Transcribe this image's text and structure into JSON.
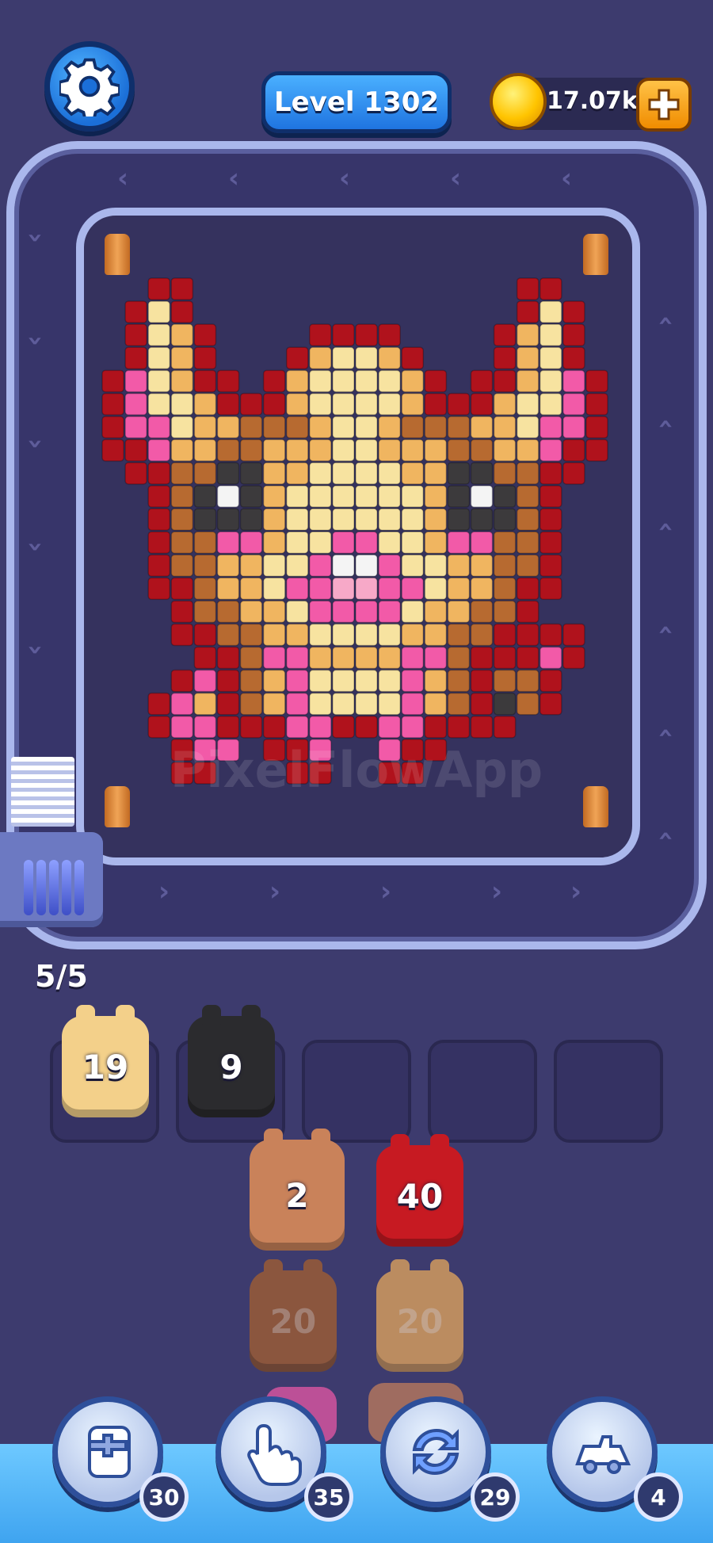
{
  "header": {
    "level_label": "Level 1302",
    "coins": "17.07k"
  },
  "watermark": "PixelFlowApp",
  "conveyor": {
    "capacity": "5/5"
  },
  "slots": [
    {
      "value": "19",
      "color": "#f3d08a"
    },
    {
      "value": "9",
      "color": "#2b2b2e"
    },
    {
      "value": "",
      "color": ""
    },
    {
      "value": "",
      "color": ""
    },
    {
      "value": "",
      "color": ""
    }
  ],
  "queue": [
    {
      "value": "2",
      "color": "#c9825a",
      "icon": "bull-head-icon",
      "faded": false
    },
    {
      "value": "40",
      "color": "#c71a22",
      "icon": "red-piece-icon",
      "faded": false
    },
    {
      "value": "20",
      "color": "#a5602f",
      "icon": "brown-piece-icon",
      "faded": true
    },
    {
      "value": "20",
      "color": "#e6a85c",
      "icon": "tan-piece-icon",
      "faded": true
    }
  ],
  "boosters": [
    {
      "icon": "add-slot-icon",
      "count": "30"
    },
    {
      "icon": "tap-hand-icon",
      "count": "35"
    },
    {
      "icon": "shuffle-icon",
      "count": "29"
    },
    {
      "icon": "train-icon",
      "count": "4"
    }
  ],
  "palette": {
    "R": "#b0121c",
    "D": "#7a0c12",
    "P": "#f25aa8",
    "C": "#f7e3a0",
    "T": "#f0b560",
    "B": "#b76a30",
    "K": "#3c3a3c",
    "W": "#f4f4f4",
    "L": "#f7a9c8"
  },
  "pixel_rows": [
    "..RR..............RR..",
    ".RCR..............RCR.",
    ".RCTR....RRRR....RTCR.",
    ".RCTR...RTCCTR...RTCR.",
    "RPCTRR.RTCCCCTR.RRTCPR",
    "RPCCTRRRTCCCCTRRRTCCPR",
    "RPPCTTBBBTCCTBBBTTCPPR",
    "RRPTTBBTTTCCTTTBBTTPRR",
    ".RRBBKKTTCCCCTTKKBBRR.",
    "..RBKWKTCCCCCCTKWKBR..",
    "..RBKKKTCCCCCCTKKKBR..",
    "..RBBPPTCCPPCCTPPBBR..",
    "..RBBTTCCPWWPCCTTBBR..",
    "..RRBTTCPPLLPPCTTBRR..",
    "...RBBTTCPPPPCTTBBR...",
    "...RRBBTTCCCCTTBBRRRR.",
    "....RRBPPTTTTPPBRRRPR.",
    "...RPRBTPCCCCPTBRBBR..",
    "..RPTRBTPCCCCPTBRKBR..",
    "..RPPRRRPPRRPPRRRR....",
    "...RPP.RRP..PRR.......",
    "...RR...RR..RR........"
  ]
}
